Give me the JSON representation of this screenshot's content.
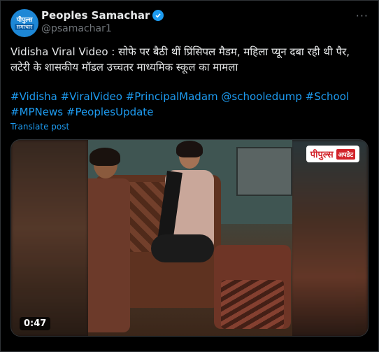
{
  "author": {
    "avatar_line1": "पीपुल्स",
    "avatar_line2": "समाचार",
    "display_name": "Peoples Samachar",
    "handle": "@psamachar1",
    "verified_icon": "verified-badge-icon"
  },
  "more_icon": "···",
  "post": {
    "text": "Vidisha Viral Video : सोफे पर बैठी थीं प्रिंसिपल मैडम, महिला प्यून दबा रही थी पैर, लटेरी के शासकीय मॉडल उच्चतर माध्यमिक स्कूल का मामला",
    "hashtags": [
      "#Vidisha",
      "#ViralVideo",
      "#PrincipalMadam",
      "@schooledump",
      "#School",
      "#MPNews",
      "#PeoplesUpdate"
    ],
    "translate_label": "Translate post"
  },
  "video": {
    "logo_main": "पीपुल्स",
    "logo_tag": "अपडेट",
    "duration": "0:47"
  },
  "colors": {
    "background": "#000000",
    "text": "#e7e9ea",
    "secondary": "#71767b",
    "link": "#1d9bf0",
    "border": "#2f3336"
  }
}
